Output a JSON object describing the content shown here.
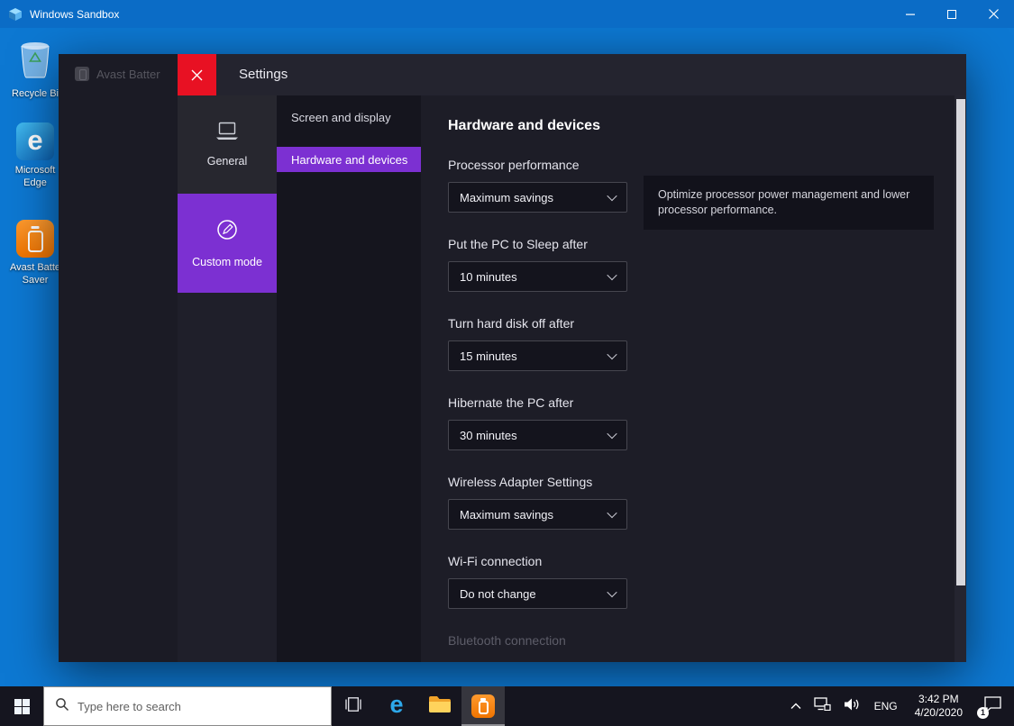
{
  "colors": {
    "titlebar_blue": "#0B6CC6",
    "desktop_blue": "#0D78D2",
    "accent_purple": "#7C30D2",
    "close_red": "#E81123",
    "avast_orange": "#F07400",
    "taskbar_dark": "#15151F"
  },
  "os_window": {
    "title": "Windows Sandbox"
  },
  "desktop": {
    "icons": [
      {
        "name": "Recycle Bin",
        "label_lines": [
          "Recycle Bi"
        ]
      },
      {
        "name": "Microsoft Edge",
        "label_lines": [
          "Microsoft",
          "Edge"
        ]
      },
      {
        "name": "Avast Battery Saver",
        "label_lines": [
          "Avast Batte",
          "Saver"
        ]
      }
    ]
  },
  "app": {
    "background_title": "Avast Batter",
    "settings_title": "Settings",
    "mode_nav": [
      {
        "label": "General",
        "selected": false
      },
      {
        "label": "Custom mode",
        "selected": true
      }
    ],
    "section_nav": [
      {
        "label": "Screen and display",
        "selected": false
      },
      {
        "label": "Hardware and devices",
        "selected": true
      }
    ],
    "content": {
      "heading": "Hardware and devices",
      "tooltip": "Optimize processor power management and lower processor performance.",
      "fields": [
        {
          "label": "Processor performance",
          "value": "Maximum savings"
        },
        {
          "label": "Put the PC to Sleep after",
          "value": "10 minutes"
        },
        {
          "label": "Turn hard disk off after",
          "value": "15 minutes"
        },
        {
          "label": "Hibernate the PC after",
          "value": "30 minutes"
        },
        {
          "label": "Wireless Adapter Settings",
          "value": "Maximum savings"
        },
        {
          "label": "Wi-Fi connection",
          "value": "Do not change"
        }
      ],
      "disabled_field_label": "Bluetooth connection"
    }
  },
  "taskbar": {
    "search_placeholder": "Type here to search",
    "language": "ENG",
    "time": "3:42 PM",
    "date": "4/20/2020",
    "notification_count": "1"
  },
  "icons": {
    "windows-sandbox-logo-icon": "blue cube",
    "minimize-icon": "horizontal bar",
    "maximize-icon": "square outline",
    "close-icon": "x cross",
    "recycle-bin-icon": "translucent bin with recycle arrows",
    "edge-icon": "blue letter e",
    "avast-battery-icon": "orange tile with white battery",
    "laptop-icon": "laptop outline",
    "custom-mode-icon": "pencil in circle",
    "chevron-down-icon": "v chevron",
    "start-icon": "windows four-pane grid",
    "search-icon": "magnifier",
    "task-view-icon": "stacked windows",
    "folder-icon": "yellow folder",
    "chevron-up-icon": "^ chevron",
    "network-icon": "ethernet pc",
    "volume-icon": "speaker with waves",
    "action-center-icon": "speech bubble"
  }
}
